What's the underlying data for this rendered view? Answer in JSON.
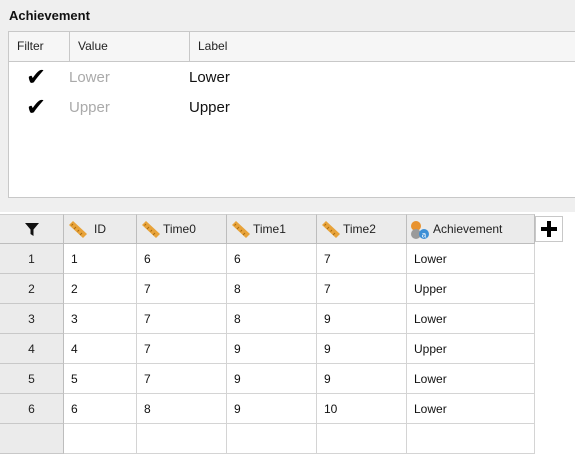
{
  "panel": {
    "title": "Achievement",
    "headers": {
      "filter": "Filter",
      "value": "Value",
      "label": "Label"
    },
    "levels": [
      {
        "value": "Lower",
        "label": "Lower",
        "checked": true
      },
      {
        "value": "Upper",
        "label": "Upper",
        "checked": true
      }
    ]
  },
  "grid": {
    "columns": [
      {
        "name": "ID",
        "type": "continuous"
      },
      {
        "name": "Time0",
        "type": "continuous"
      },
      {
        "name": "Time1",
        "type": "continuous"
      },
      {
        "name": "Time2",
        "type": "continuous"
      },
      {
        "name": "Achievement",
        "type": "nominal"
      }
    ],
    "rows": [
      {
        "num": "1",
        "cells": [
          "1",
          "6",
          "6",
          "7",
          "Lower"
        ]
      },
      {
        "num": "2",
        "cells": [
          "2",
          "7",
          "8",
          "7",
          "Upper"
        ]
      },
      {
        "num": "3",
        "cells": [
          "3",
          "7",
          "8",
          "9",
          "Lower"
        ]
      },
      {
        "num": "4",
        "cells": [
          "4",
          "7",
          "9",
          "9",
          "Upper"
        ]
      },
      {
        "num": "5",
        "cells": [
          "5",
          "7",
          "9",
          "9",
          "Lower"
        ]
      },
      {
        "num": "6",
        "cells": [
          "6",
          "8",
          "9",
          "10",
          "Lower"
        ]
      },
      {
        "num": "",
        "cells": [
          "",
          "",
          "",
          "",
          ""
        ]
      }
    ]
  },
  "colors": {
    "ruler": "#e8a33a",
    "nominal_circle": "#e8922e",
    "nominal_badge": "#3b8fd6"
  }
}
